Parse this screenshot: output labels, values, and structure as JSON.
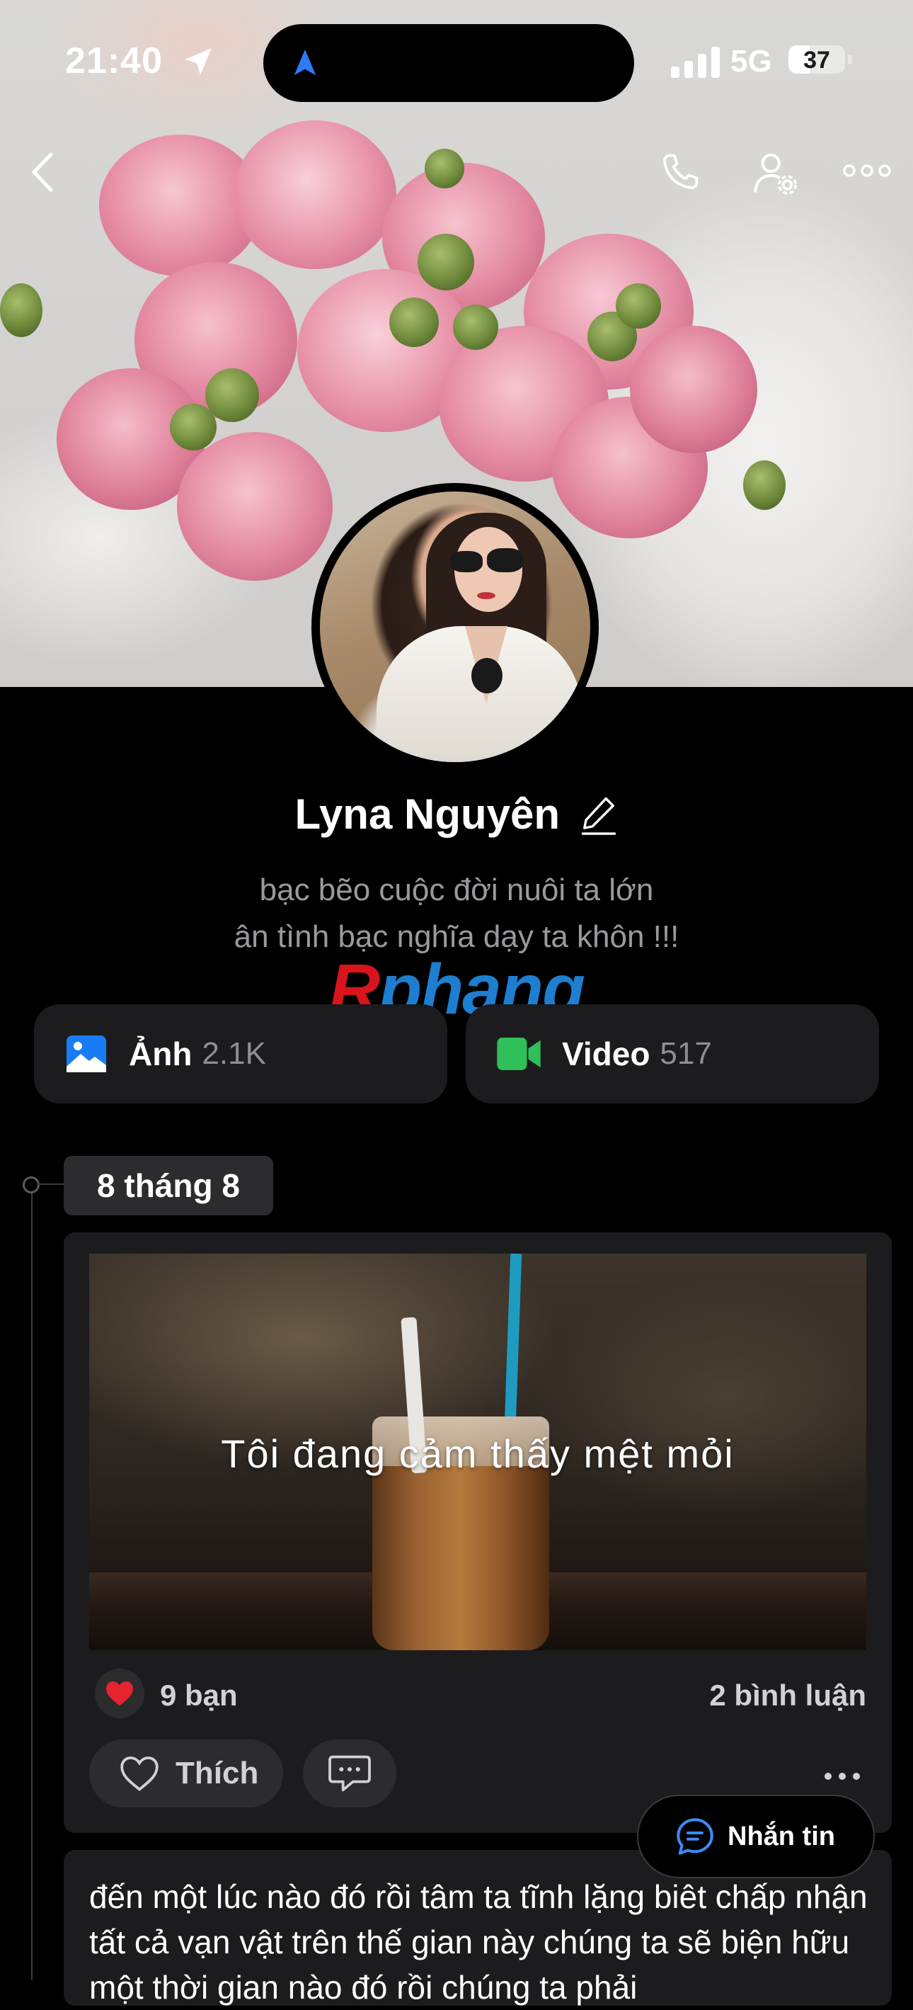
{
  "status_bar": {
    "time": "21:40",
    "network": "5G",
    "battery_level": "37"
  },
  "nav": {
    "back_icon": "chevron-left-icon",
    "call_icon": "phone-icon",
    "settings_icon": "user-settings-icon",
    "more_icon": "more-horizontal-icon"
  },
  "profile": {
    "name": "Lyna Nguyên",
    "bio_line1": "bạc bẽo cuộc đời nuôi ta lớn",
    "bio_line2": "ân tình bạc nghĩa dạy ta khôn !!!",
    "watermark_r": "R",
    "watermark_rest": "phang"
  },
  "media": {
    "photos_label": "Ảnh",
    "photos_count": "2.1K",
    "videos_label": "Video",
    "videos_count": "517",
    "photos_color": "#1a7cf5",
    "videos_color": "#30c05a"
  },
  "timeline": {
    "date": "8 tháng 8",
    "post": {
      "image_caption": "Tôi đang cảm thấy mệt mỏi",
      "likes": "9 bạn",
      "comments": "2 bình luận",
      "like_label": "Thích"
    },
    "next_post_text": "đến một lúc nào đó rồi tâm ta tĩnh lặng biêt chấp nhận tất cả vạn vật trên thế gian này chúng ta sẽ biện hữu một thời gian nào đó rồi chúng ta phải"
  },
  "message_button": {
    "label": "Nhắn tin"
  },
  "colors": {
    "background": "#000000",
    "card": "#1c1c1e",
    "chip": "#2c2c2e",
    "secondary_text": "#8e8e93",
    "heart": "#e5242f"
  }
}
